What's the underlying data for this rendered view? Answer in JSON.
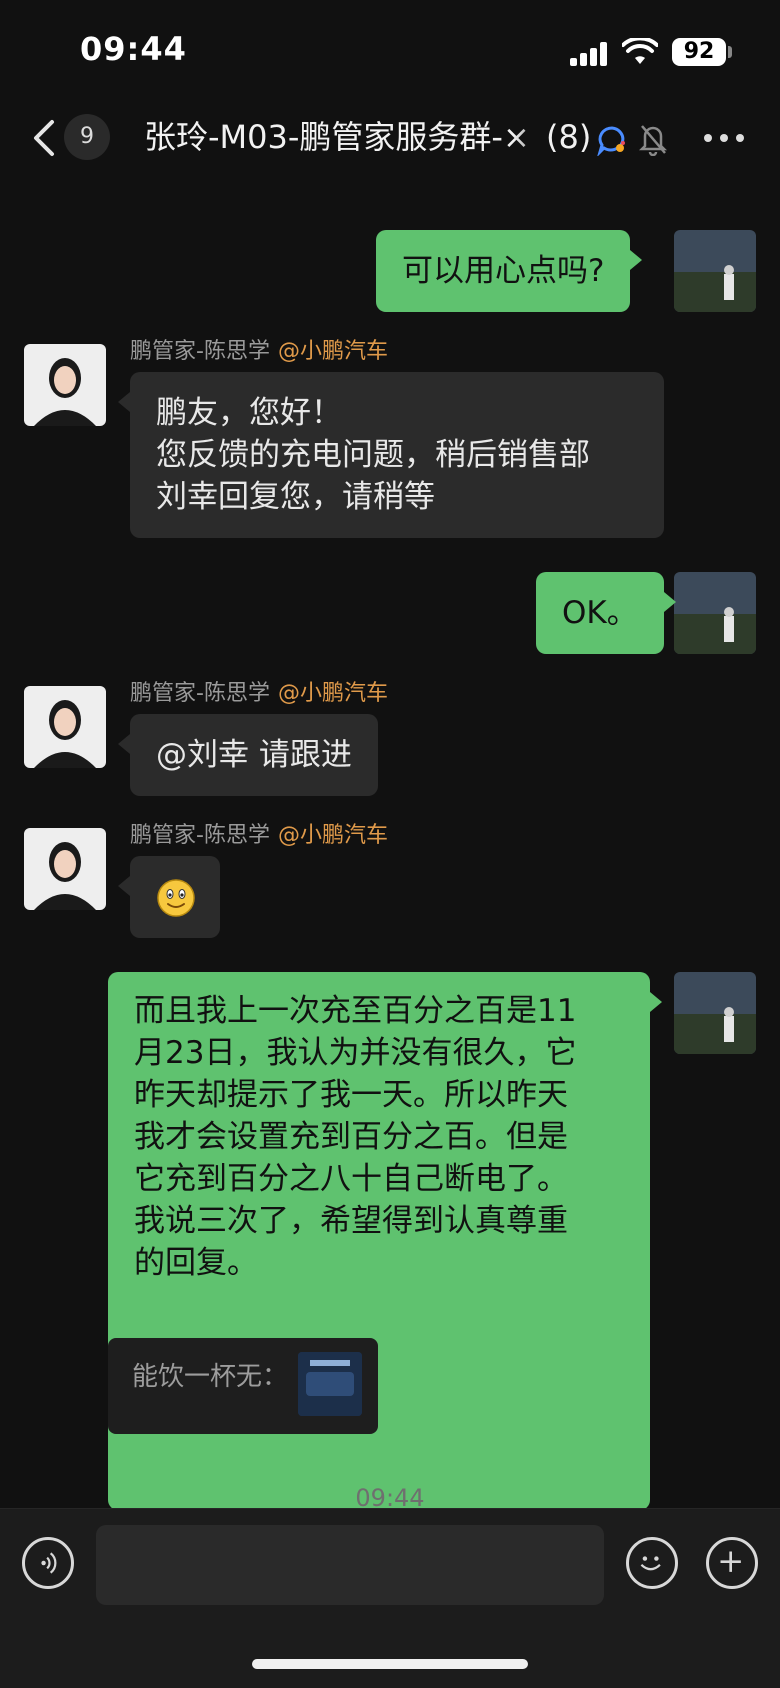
{
  "status_bar": {
    "time": "09:44",
    "battery": "92"
  },
  "header": {
    "unread_count": "9",
    "title": "张玲-M03-鹏管家服务群-×",
    "member_count": "(8)"
  },
  "messages": [
    {
      "side": "right",
      "text": "可以用心点吗?"
    },
    {
      "side": "left",
      "sender": "鹏管家-陈思学",
      "org": "@小鹏汽车",
      "lines": [
        "鹏友，您好！",
        "您反馈的充电问题，稍后销售部",
        "刘幸回复您，请稍等"
      ]
    },
    {
      "side": "right",
      "text": "OK。"
    },
    {
      "side": "left",
      "sender": "鹏管家-陈思学",
      "org": "@小鹏汽车",
      "text": "@刘幸 请跟进"
    },
    {
      "side": "left",
      "sender": "鹏管家-陈思学",
      "org": "@小鹏汽车",
      "emoji": "smile-emoji"
    },
    {
      "side": "right",
      "lines": [
        "而且我上一次充至百分之百是11",
        "月23日，我认为并没有很久，它",
        "昨天却提示了我一天。所以昨天",
        "我才会设置充到百分之百。但是",
        "它充到百分之八十自己断电了。",
        "我说三次了，希望得到认真尊重",
        "的回复。"
      ]
    }
  ],
  "quote": {
    "text": "能饮一杯无："
  },
  "timestamp": "09:44",
  "input": {
    "placeholder": "",
    "value": ""
  }
}
